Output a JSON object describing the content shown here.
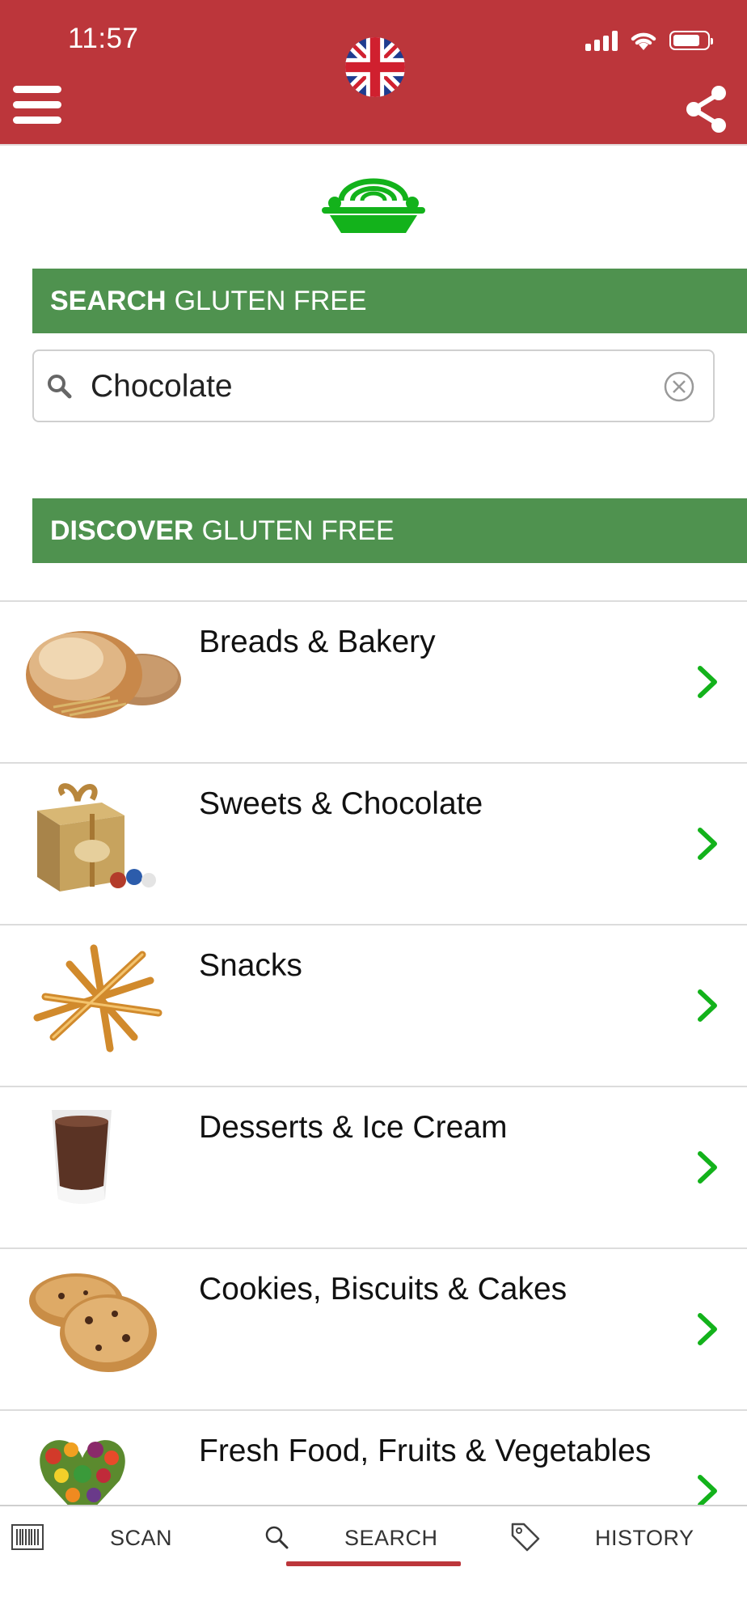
{
  "status_bar": {
    "time": "11:57"
  },
  "header": {
    "flag_icon": "uk-flag-icon",
    "menu_icon": "hamburger-menu-icon",
    "share_icon": "share-icon",
    "color": "#bc363b"
  },
  "logo": {
    "icon": "gluten-free-bowl-logo",
    "color": "#13b21b"
  },
  "search_section": {
    "title_bold": "SEARCH",
    "title_rest": "GLUTEN FREE",
    "color": "#4f924f"
  },
  "search": {
    "value": "Chocolate",
    "placeholder": ""
  },
  "discover_section": {
    "title_bold": "DISCOVER",
    "title_rest": "GLUTEN FREE"
  },
  "categories": [
    {
      "label": "Breads & Bakery",
      "thumbnail": "bread-image"
    },
    {
      "label": "Sweets & Chocolate",
      "thumbnail": "chocolate-box-image"
    },
    {
      "label": "Snacks",
      "thumbnail": "breadsticks-image"
    },
    {
      "label": "Desserts & Ice Cream",
      "thumbnail": "dessert-glass-image"
    },
    {
      "label": "Cookies, Biscuits & Cakes",
      "thumbnail": "cookies-image"
    },
    {
      "label": "Fresh Food, Fruits & Vegetables",
      "thumbnail": "vegetables-image"
    }
  ],
  "tabbar": {
    "scan": "SCAN",
    "search": "SEARCH",
    "history": "HISTORY",
    "active": "search"
  }
}
